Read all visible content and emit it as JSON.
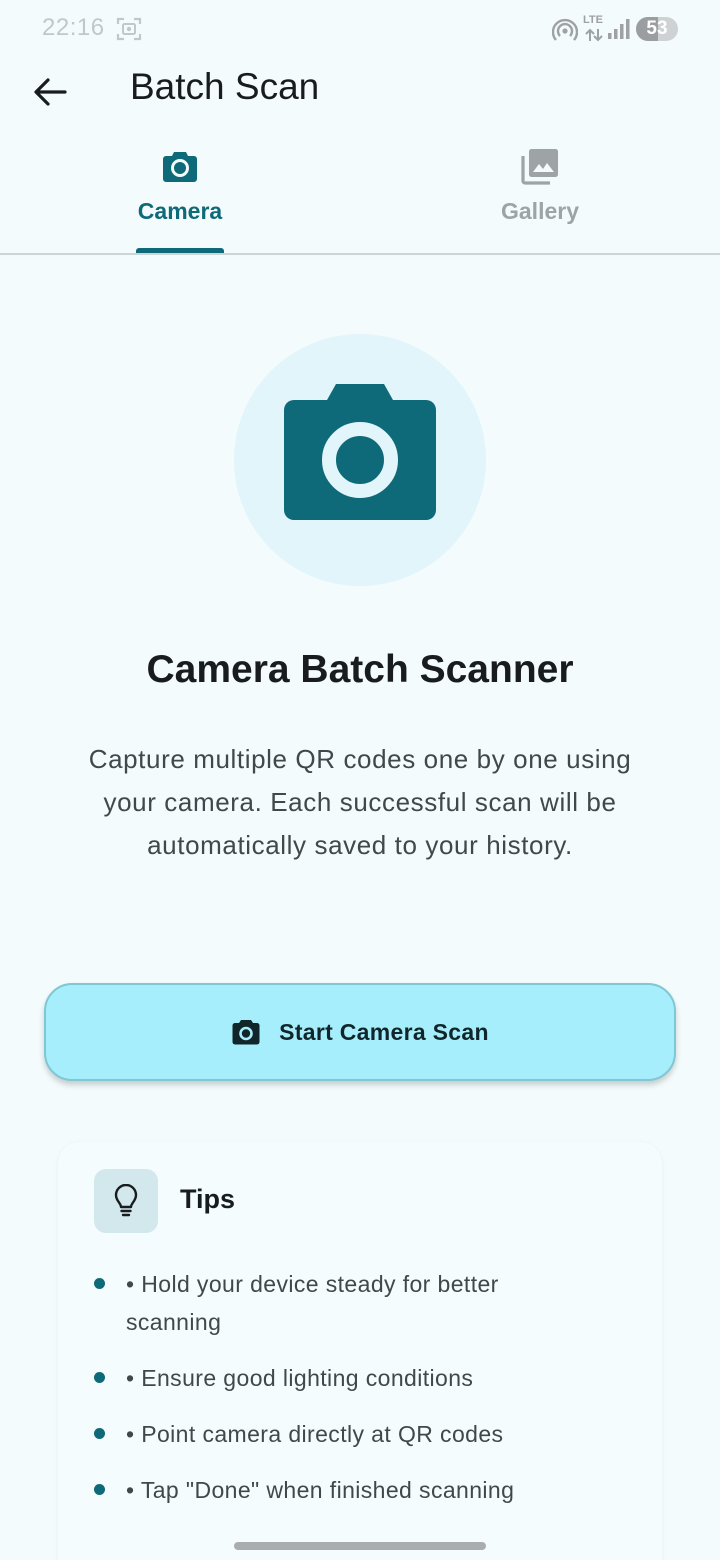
{
  "status_bar": {
    "time": "22:16",
    "network": "LTE",
    "battery": "53",
    "battery_level_percent": 53
  },
  "app_bar": {
    "title": "Batch Scan",
    "back_icon": "arrow-back-icon"
  },
  "tabs": [
    {
      "label": "Camera",
      "icon": "camera-icon",
      "selected": true
    },
    {
      "label": "Gallery",
      "icon": "photo-library-icon",
      "selected": false
    }
  ],
  "hero": {
    "icon": "camera-icon",
    "title": "Camera Batch Scanner",
    "description": "Capture multiple QR codes one by one using your camera. Each successful scan will be automatically saved to your history."
  },
  "start_button": {
    "label": "Start Camera Scan",
    "icon": "camera-icon"
  },
  "tips": {
    "title": "Tips",
    "icon": "lightbulb-icon",
    "items": [
      "• Hold your device steady for better scanning",
      "• Ensure good lighting conditions",
      "• Point camera directly at QR codes",
      "• Tap \"Done\" when finished scanning"
    ]
  },
  "colors": {
    "background": "#f3fbfd",
    "primary": "#0e6a78",
    "button_fill": "#a6eefb",
    "inactive_tab": "#9ea3a6"
  }
}
